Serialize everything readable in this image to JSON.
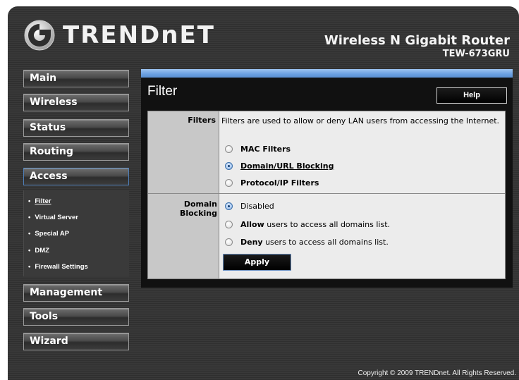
{
  "brand": {
    "logo_text": "TRENDnET"
  },
  "header": {
    "product_title": "Wireless N Gigabit Router",
    "model": "TEW-673GRU"
  },
  "sidebar": {
    "items": [
      {
        "label": "Main"
      },
      {
        "label": "Wireless"
      },
      {
        "label": "Status"
      },
      {
        "label": "Routing"
      },
      {
        "label": "Access"
      },
      {
        "label": "Management"
      },
      {
        "label": "Tools"
      },
      {
        "label": "Wizard"
      }
    ],
    "submenu": [
      {
        "label": "Filter"
      },
      {
        "label": "Virtual Server"
      },
      {
        "label": "Special AP"
      },
      {
        "label": "DMZ"
      },
      {
        "label": "Firewall Settings"
      }
    ],
    "bullet": "•"
  },
  "panel": {
    "title": "Filter",
    "help_label": "Help",
    "filters_label": "Filters",
    "filters_desc": "Filters are used to allow or deny LAN users from accessing the Internet.",
    "filter_options": [
      "MAC Filters",
      "Domain/URL Blocking",
      "Protocol/IP Filters"
    ],
    "filter_selected": "Domain/URL Blocking",
    "domain_label": "Domain Blocking",
    "domain_options": {
      "disabled": "Disabled",
      "allow_bold": "Allow",
      "allow_rest": " users to access all domains list.",
      "deny_bold": "Deny",
      "deny_rest": " users to access all domains list."
    },
    "domain_selected": "Disabled",
    "apply_label": "Apply"
  },
  "footer": {
    "copyright": "Copyright © 2009 TRENDnet. All Rights Reserved."
  },
  "colors": {
    "accent_blue": "#6aa0e0",
    "panel_bg": "#111111",
    "row_label_bg": "#c8c8c8",
    "row_value_bg": "#ececec"
  }
}
